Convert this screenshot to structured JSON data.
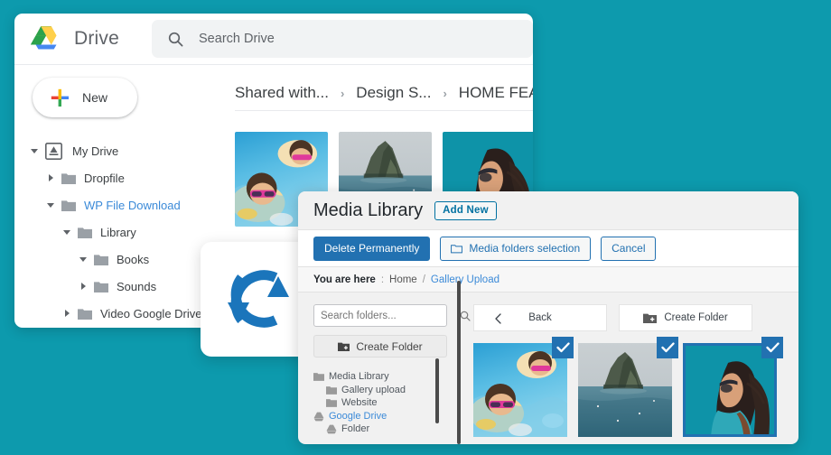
{
  "theme": {
    "background": "#0d9aad",
    "wp_blue": "#2271b1",
    "link_blue": "#3b8ad8"
  },
  "drive": {
    "brand": "Drive",
    "logo_icon": "google-drive-logo",
    "search": {
      "icon": "search-icon",
      "placeholder": "Search Drive",
      "value": ""
    },
    "new_button": {
      "label": "New",
      "icon": "plus-icon"
    },
    "tree": [
      {
        "label": "My Drive",
        "indent": 0,
        "caret": "down",
        "icon": "drive-badge-icon",
        "highlight": false
      },
      {
        "label": "Dropfile",
        "indent": 1,
        "caret": "right",
        "icon": "folder-icon",
        "highlight": false
      },
      {
        "label": "WP File Download",
        "indent": 1,
        "caret": "down",
        "icon": "folder-icon",
        "highlight": true
      },
      {
        "label": "Library",
        "indent": 2,
        "caret": "down",
        "icon": "folder-icon",
        "highlight": false
      },
      {
        "label": "Books",
        "indent": 3,
        "caret": "down",
        "icon": "folder-icon",
        "highlight": false
      },
      {
        "label": "Sounds",
        "indent": 3,
        "caret": "right",
        "icon": "folder-icon",
        "highlight": false
      },
      {
        "label": "Video Google Drive",
        "indent": 2,
        "caret": "right",
        "icon": "folder-icon",
        "highlight": false
      }
    ],
    "breadcrumb": [
      "Shared with...",
      "Design S...",
      "HOME FEA"
    ],
    "breadcrumb_separator": "›",
    "thumbnails": [
      "pool-kids-sunglasses",
      "island-sea-cliff",
      "woman-teal-portrait"
    ]
  },
  "sync_badge": {
    "icon": "sync-refresh-icon",
    "color": "#1b75bb"
  },
  "media_library": {
    "title": "Media Library",
    "add_new": "Add New",
    "toolbar": [
      {
        "label": "Delete Permanently",
        "style": "primary",
        "icon": null
      },
      {
        "label": "Media folders selection",
        "style": "secondary",
        "icon": "folder-icon"
      },
      {
        "label": "Cancel",
        "style": "secondary",
        "icon": null
      }
    ],
    "you_are_here": {
      "label": "You are here",
      "colon": ":",
      "crumbs": [
        {
          "text": "Home",
          "link": false
        },
        {
          "text": "Gallery Upload",
          "link": true
        }
      ],
      "separator": "/"
    },
    "left_panel": {
      "search_placeholder": "Search folders...",
      "search_value": "",
      "search_icon": "search-icon",
      "create_folder": {
        "label": "Create Folder",
        "icon": "folder-plus-icon"
      },
      "tree": [
        {
          "label": "Media Library",
          "indent": 0,
          "icon": "folder-icon",
          "link": false
        },
        {
          "label": "Gallery upload",
          "indent": 1,
          "icon": "folder-icon",
          "link": false
        },
        {
          "label": "Website",
          "indent": 1,
          "icon": "folder-icon",
          "link": false
        },
        {
          "label": "Google Drive",
          "indent": 0,
          "icon": "drive-small-icon",
          "link": true
        },
        {
          "label": "Folder",
          "indent": 1,
          "icon": "drive-small-icon",
          "link": false
        }
      ]
    },
    "right_panel": {
      "back_button": {
        "label": "Back",
        "icon": "chevron-left-icon"
      },
      "create_folder": {
        "label": "Create Folder",
        "icon": "folder-plus-icon"
      },
      "items": [
        {
          "name": "pool-kids-sunglasses",
          "selected": false,
          "checked": true
        },
        {
          "name": "island-sea-cliff",
          "selected": false,
          "checked": true
        },
        {
          "name": "woman-teal-portrait",
          "selected": true,
          "checked": true
        }
      ]
    }
  }
}
